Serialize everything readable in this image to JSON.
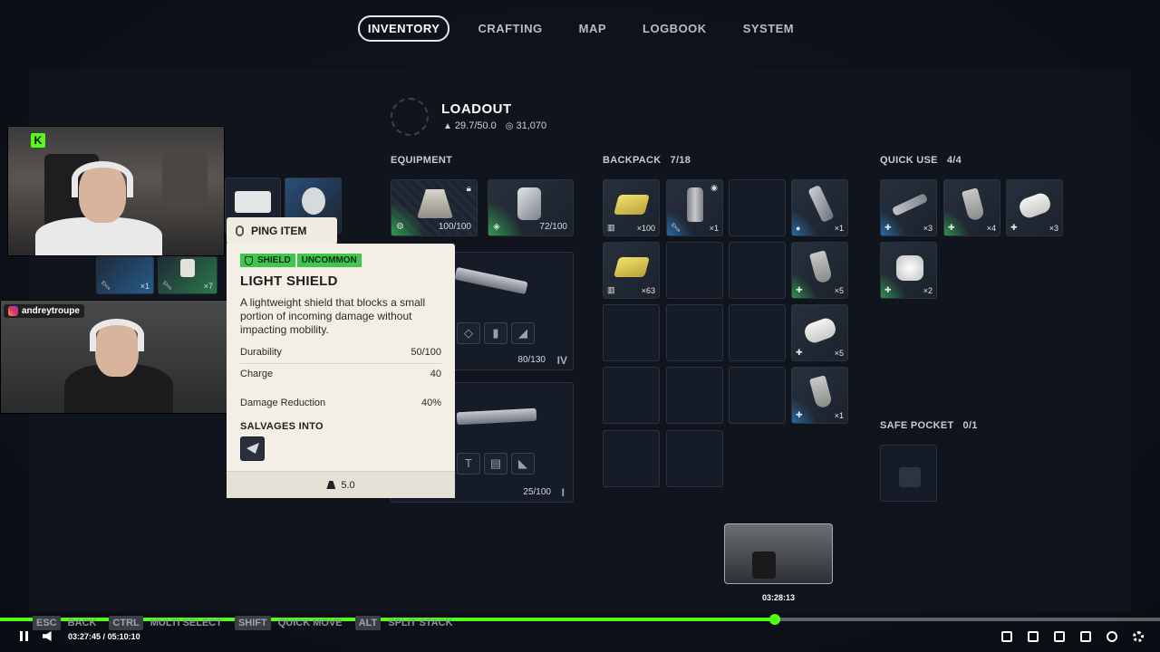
{
  "nav": {
    "tabs": [
      "INVENTORY",
      "CRAFTING",
      "MAP",
      "LOGBOOK",
      "SYSTEM"
    ],
    "active": "INVENTORY"
  },
  "loadout": {
    "title": "LOADOUT",
    "weight": "29.7/50.0",
    "credits": "31,070"
  },
  "equipment": {
    "title": "EQUIPMENT",
    "shield_durability": "100/100",
    "augment_value": "72/100",
    "weapon1_value": "80/130",
    "weapon1_tier": "IV",
    "weapon2_value": "25/100",
    "weapon2_tier": "I"
  },
  "backpack": {
    "title": "BACKPACK",
    "count": "7/18",
    "slots": [
      {
        "qty": "×100",
        "icon": "ammo-icon"
      },
      {
        "qty": "×1",
        "icon": "wrench-icon"
      },
      {
        "qty": "",
        "icon": ""
      },
      {
        "qty": "×1",
        "icon": "grenade-icon"
      },
      {
        "qty": "×63",
        "icon": "ammo-icon"
      },
      {
        "qty": "×5",
        "icon": "plus-icon"
      },
      {
        "qty": "×5",
        "icon": "plus-icon"
      },
      {
        "qty": "×1",
        "icon": "plus-icon"
      }
    ]
  },
  "quick_use": {
    "title": "QUICK USE",
    "count": "4/4",
    "slots": [
      {
        "qty": "×3"
      },
      {
        "qty": "×4"
      },
      {
        "qty": "×3"
      },
      {
        "qty": "×2"
      }
    ]
  },
  "safe_pocket": {
    "title": "SAFE POCKET",
    "count": "0/1"
  },
  "left_partial": {
    "qty_a": "×1",
    "qty_b": "×1",
    "qty_c": "×7"
  },
  "tooltip": {
    "ping_label": "PING ITEM",
    "tag1": "SHIELD",
    "tag2": "UNCOMMON",
    "name": "LIGHT SHIELD",
    "description": "A lightweight shield that blocks a small portion of incoming damage without impacting mobility.",
    "stats": [
      {
        "label": "Durability",
        "value": "50/100"
      },
      {
        "label": "Charge",
        "value": "40"
      },
      {
        "label": "Damage Reduction",
        "value": "40%"
      }
    ],
    "salvage_title": "SALVAGES INTO",
    "weight": "5.0"
  },
  "stream": {
    "instagram_handle": "andreytroupe",
    "kick_badge": "K"
  },
  "hints": [
    {
      "key": "ESC",
      "label": "BACK"
    },
    {
      "key": "CTRL",
      "label": "MULTI SELECT"
    },
    {
      "key": "SHIFT",
      "label": "QUICK MOVE"
    },
    {
      "key": "ALT",
      "label": "SPLIT STACK"
    }
  ],
  "player": {
    "current_time": "03:27:45",
    "separator": "/",
    "total_time": "05:10:10",
    "preview_time": "03:28:13",
    "progress": 0.668,
    "accent_color": "#53fc18"
  },
  "colors": {
    "uncommon": "#3ec64f",
    "rare_glow": "#2a8de0"
  }
}
